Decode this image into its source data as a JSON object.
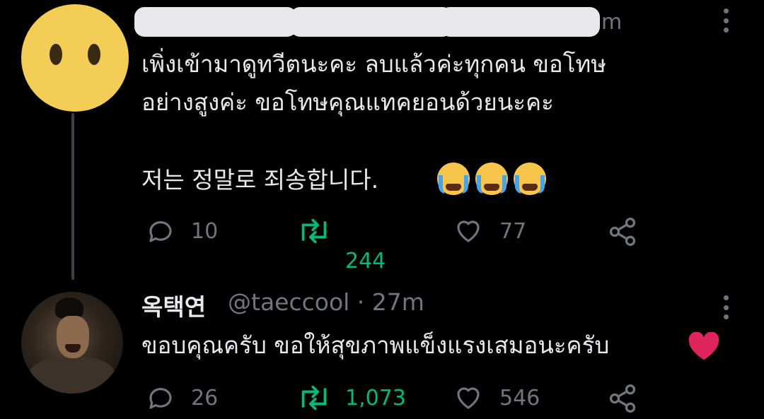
{
  "tweets": [
    {
      "time": "m",
      "text_lines": [
        "เพิ่งเข้ามาดูทวีตนะคะ ลบแล้วค่ะทุกคน ขอโทษ",
        "อย่างสูงค่ะ ขอโทษคุณแทคยอนด้วยนะคะ",
        "저는 정말로 죄송합니다."
      ],
      "emoji": [
        "loudly-crying-face",
        "loudly-crying-face",
        "loudly-crying-face"
      ],
      "replies": "10",
      "retweets": "244",
      "likes": "77"
    },
    {
      "name": "옥택연",
      "handle_time": "@taeccool · 27m",
      "text": "ขอบคุณครับ ขอให้สุขภาพแข็งแรงเสมอนะครับ",
      "emoji": "red-heart",
      "replies": "26",
      "retweets": "1,073",
      "likes": "546"
    }
  ],
  "colors": {
    "background": "#000000",
    "text": "#e7e9ea",
    "muted": "#71767b",
    "retweet_green": "#00ba7c",
    "heart_red": "#e0245e"
  }
}
